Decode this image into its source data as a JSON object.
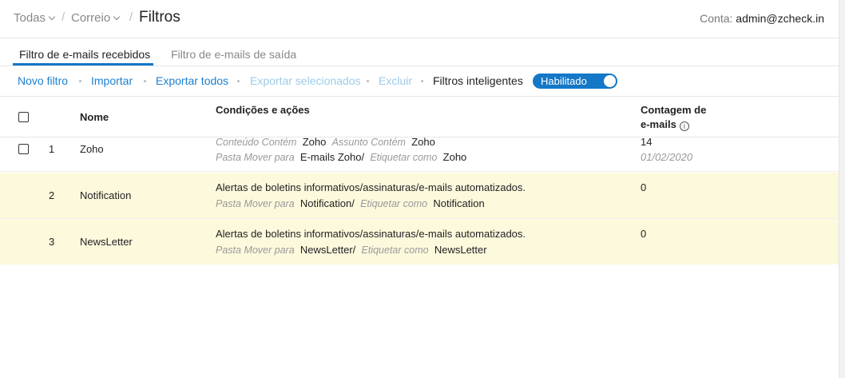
{
  "breadcrumb": {
    "item1": "Todas",
    "item2": "Correio",
    "separator": "/",
    "current": "Filtros"
  },
  "account": {
    "label": "Conta:",
    "email": "admin@zcheck.in"
  },
  "tabs": [
    {
      "label": "Filtro de e-mails recebidos",
      "active": true
    },
    {
      "label": "Filtro de e-mails de saída",
      "active": false
    }
  ],
  "toolbar": {
    "new_filter": "Novo filtro",
    "import": "Importar",
    "export_all": "Exportar todos",
    "export_selected": "Exportar selecionados",
    "delete": "Excluir",
    "smart_filters": "Filtros inteligentes",
    "smart_filters_state": "Habilitado"
  },
  "table": {
    "headers": {
      "name": "Nome",
      "conditions": "Condições e ações",
      "count_line1": "Contagem de",
      "count_line2": "e-mails",
      "info_icon": "i"
    },
    "rows": [
      {
        "index": "1",
        "name": "Zoho",
        "cond_label1": "Conteúdo Contém",
        "cond_value1": "Zoho",
        "cond_label2": "Assunto Contém",
        "cond_value2": "Zoho",
        "action_label1": "Pasta Mover para",
        "action_value1": "E-mails Zoho/",
        "action_label2": "Etiquetar como",
        "action_value2": "Zoho",
        "count": "14",
        "date": "01/02/2020"
      },
      {
        "index": "2",
        "name": "Notification",
        "condition": "Alertas de boletins informativos/assinaturas/e-mails automatizados.",
        "action_label1": "Pasta Mover para",
        "action_value1": "Notification/",
        "action_label2": "Etiquetar como",
        "action_value2": "Notification",
        "count": "0"
      },
      {
        "index": "3",
        "name": "NewsLetter",
        "condition": "Alertas de boletins informativos/assinaturas/e-mails automatizados.",
        "action_label1": "Pasta Mover para",
        "action_value1": "NewsLetter/",
        "action_label2": "Etiquetar como",
        "action_value2": "NewsLetter",
        "count": "0"
      }
    ]
  },
  "colors": {
    "accent": "#1477c7",
    "link": "#1c7fd0",
    "disabled_link": "#9ccbe8",
    "highlight_row": "#fdf9dd"
  }
}
